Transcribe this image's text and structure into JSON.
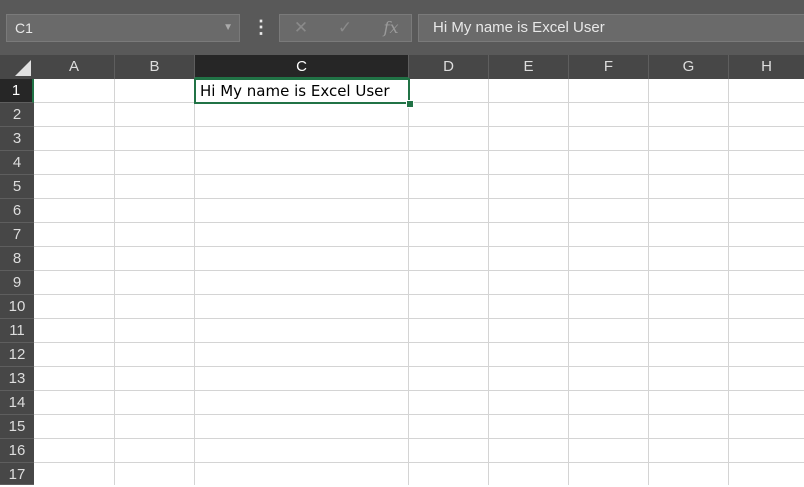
{
  "name_box": {
    "value": "C1"
  },
  "formula_bar": {
    "value": "Hi My name is Excel User",
    "fx_label": "fx"
  },
  "columns": [
    "A",
    "B",
    "C",
    "D",
    "E",
    "F",
    "G",
    "H"
  ],
  "rows": [
    "1",
    "2",
    "3",
    "4",
    "5",
    "6",
    "7",
    "8",
    "9",
    "10",
    "11",
    "12",
    "13",
    "14",
    "15",
    "16",
    "17"
  ],
  "active_cell": {
    "ref": "C1",
    "value": "Hi My name is Excel User"
  },
  "colors": {
    "accent": "#217346",
    "header_bg": "#474747",
    "selected_header_bg": "#262626"
  }
}
